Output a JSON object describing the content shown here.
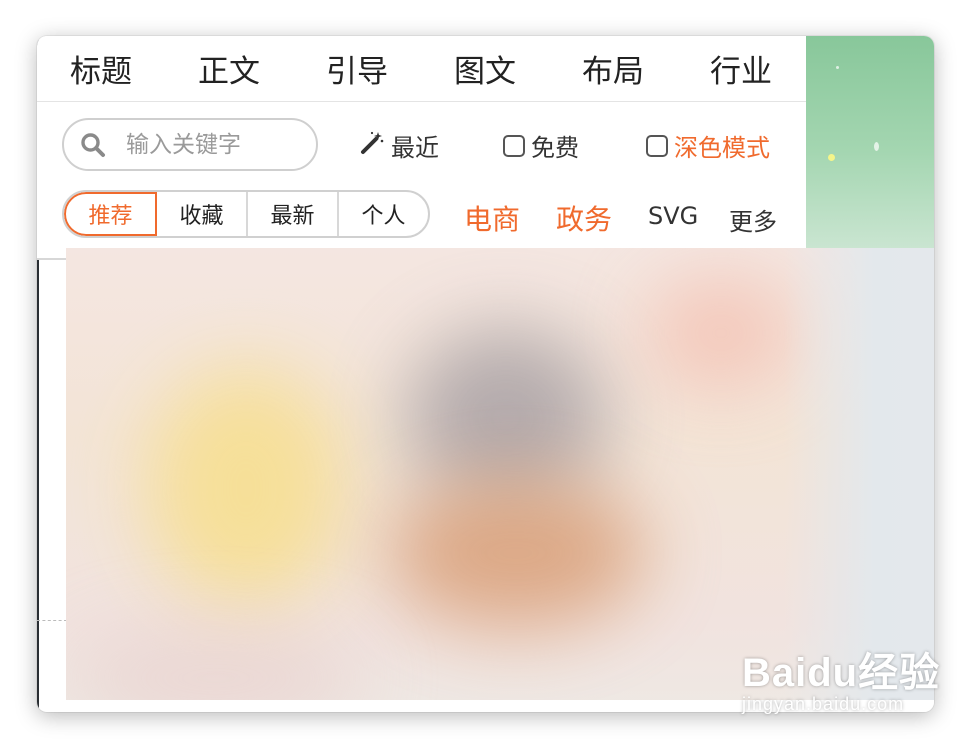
{
  "categories": [
    "标题",
    "正文",
    "引导",
    "图文",
    "布局",
    "行业"
  ],
  "search": {
    "placeholder": "输入关键字",
    "value": ""
  },
  "options": {
    "recent_label": "最近",
    "free_label": "免费",
    "free_checked": false,
    "dark_mode_label": "深色模式",
    "dark_mode_checked": false
  },
  "tabs": [
    {
      "label": "推荐",
      "active": true
    },
    {
      "label": "收藏",
      "active": false
    },
    {
      "label": "最新",
      "active": false
    },
    {
      "label": "个人",
      "active": false
    }
  ],
  "links": {
    "ecommerce": "电商",
    "government": "政务",
    "svg": "SVG",
    "more": "更多"
  },
  "watermark": {
    "brand": "Baidu经验",
    "url": "jingyan.baidu.com"
  },
  "colors": {
    "accent": "#f06a2d",
    "text": "#222222",
    "border": "#d0d0d0",
    "green_bg": "#88c79a"
  },
  "icons": {
    "search": "search-icon",
    "recent": "magic-wand-icon",
    "checkbox": "checkbox-icon"
  }
}
